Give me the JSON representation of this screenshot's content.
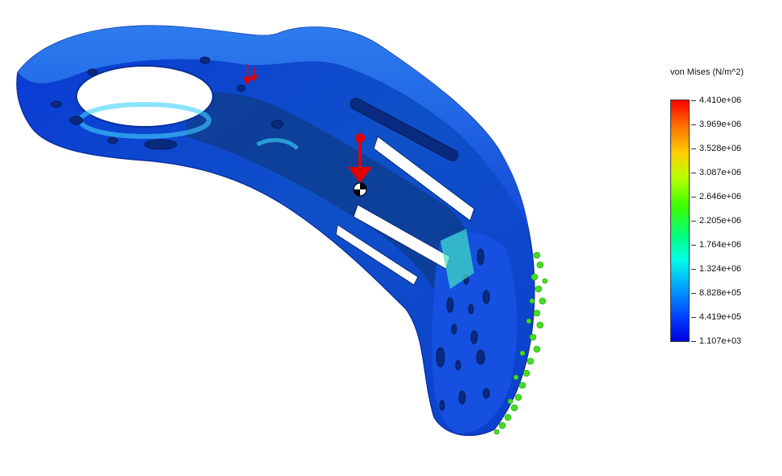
{
  "legend": {
    "title": "von Mises (N/m^2)",
    "ticks": [
      "4.410e+06",
      "3.969e+06",
      "3.528e+06",
      "3.087e+06",
      "2.646e+06",
      "2.205e+06",
      "1.764e+06",
      "1.324e+06",
      "8.828e+05",
      "4.419e+05",
      "1.107e+03"
    ],
    "colors": {
      "max": "#ff0000",
      "high": "#ffd000",
      "mid": "#3cff00",
      "low_mid": "#00ffe6",
      "low": "#0040ff",
      "min": "#0000e0"
    }
  },
  "model": {
    "part": "curved-bracket-stress-plot",
    "load_icon": "red-force-arrow-icon",
    "fixture_icon": "green-fixture-icon",
    "center_icon": "center-of-mass-icon"
  }
}
